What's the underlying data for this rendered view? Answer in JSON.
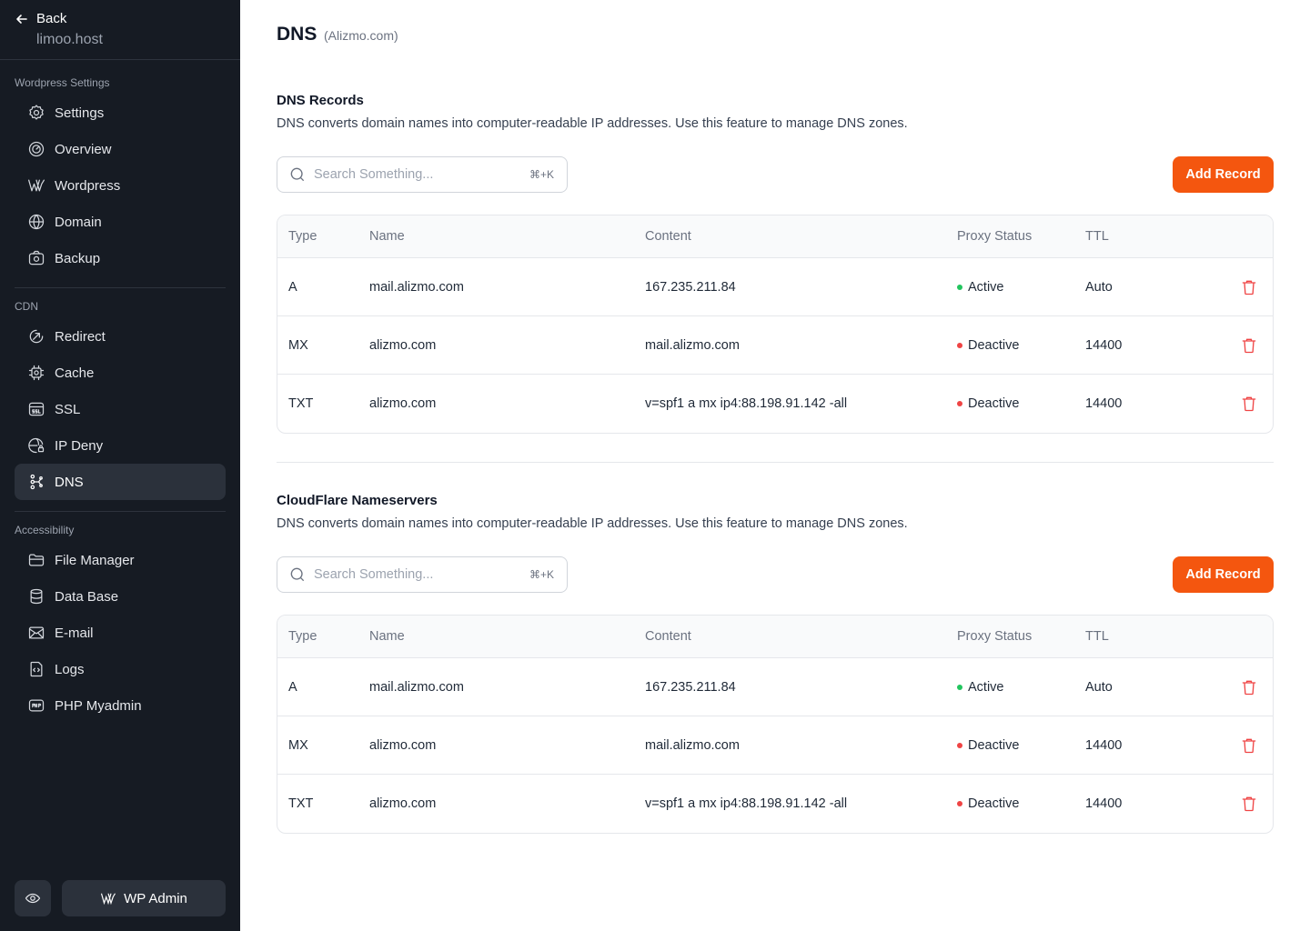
{
  "sidebar": {
    "back_label": "Back",
    "host": "limoo.host",
    "sections": [
      {
        "title": "Wordpress Settings"
      },
      {
        "title": "CDN"
      },
      {
        "title": "Accessibility"
      }
    ],
    "items": [
      {
        "label": "Settings",
        "icon": "gear-icon"
      },
      {
        "label": "Overview",
        "icon": "gauge-icon"
      },
      {
        "label": "Wordpress",
        "icon": "wordpress-icon"
      },
      {
        "label": "Domain",
        "icon": "globe-icon"
      },
      {
        "label": "Backup",
        "icon": "camera-icon"
      },
      {
        "label": "Redirect",
        "icon": "redirect-icon"
      },
      {
        "label": "Cache",
        "icon": "chip-icon"
      },
      {
        "label": "SSL",
        "icon": "ssl-icon"
      },
      {
        "label": "IP Deny",
        "icon": "globe-lock-icon"
      },
      {
        "label": "DNS",
        "icon": "dns-icon",
        "active": true
      },
      {
        "label": "File Manager",
        "icon": "folder-icon"
      },
      {
        "label": "Data Base",
        "icon": "database-icon"
      },
      {
        "label": "E-mail",
        "icon": "mail-icon"
      },
      {
        "label": "Logs",
        "icon": "code-file-icon"
      },
      {
        "label": "PHP Myadmin",
        "icon": "php-icon"
      }
    ],
    "wp_admin_label": "WP Admin"
  },
  "page": {
    "title": "DNS",
    "subtitle": "(Alizmo.com)"
  },
  "sections": [
    {
      "title": "DNS Records",
      "description": "DNS converts domain names into computer-readable IP addresses. Use this feature to manage DNS zones.",
      "search_placeholder": "Search Something...",
      "search_shortcut": "⌘+K",
      "add_label": "Add Record",
      "columns": [
        "Type",
        "Name",
        "Content",
        "Proxy Status",
        "TTL"
      ],
      "rows": [
        {
          "type": "A",
          "name": "mail.alizmo.com",
          "content": "167.235.211.84",
          "status": "Active",
          "ttl": "Auto"
        },
        {
          "type": "MX",
          "name": "alizmo.com",
          "content": "mail.alizmo.com",
          "status": "Deactive",
          "ttl": "14400"
        },
        {
          "type": "TXT",
          "name": "alizmo.com",
          "content": "v=spf1 a mx ip4:88.198.91.142 -all",
          "status": "Deactive",
          "ttl": "14400"
        }
      ]
    },
    {
      "title": "CloudFlare Nameservers",
      "description": "DNS converts domain names into computer-readable IP addresses. Use this feature to manage DNS zones.",
      "search_placeholder": "Search Something...",
      "search_shortcut": "⌘+K",
      "add_label": "Add Record",
      "columns": [
        "Type",
        "Name",
        "Content",
        "Proxy Status",
        "TTL"
      ],
      "rows": [
        {
          "type": "A",
          "name": "mail.alizmo.com",
          "content": "167.235.211.84",
          "status": "Active",
          "ttl": "Auto"
        },
        {
          "type": "MX",
          "name": "alizmo.com",
          "content": "mail.alizmo.com",
          "status": "Deactive",
          "ttl": "14400"
        },
        {
          "type": "TXT",
          "name": "alizmo.com",
          "content": "v=spf1 a mx ip4:88.198.91.142 -all",
          "status": "Deactive",
          "ttl": "14400"
        }
      ]
    }
  ],
  "colors": {
    "accent": "#f4560f",
    "sidebar_bg": "#161b23",
    "active_status": "#22c55e",
    "inactive_status": "#ef4444"
  }
}
